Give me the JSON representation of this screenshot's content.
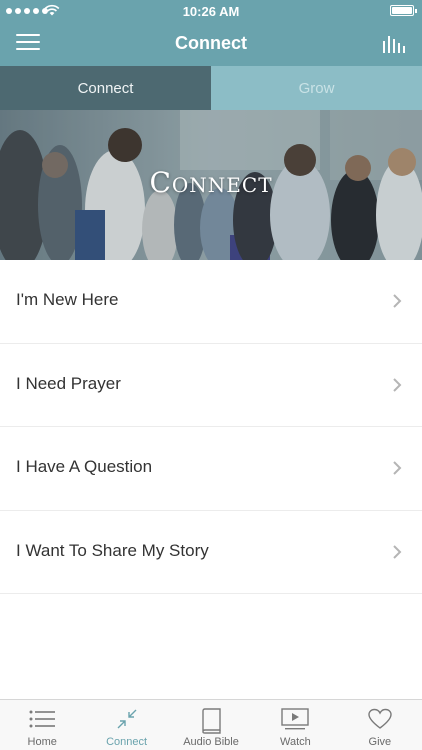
{
  "status_bar": {
    "time": "10:26 AM"
  },
  "nav": {
    "title": "Connect"
  },
  "segments": [
    {
      "label": "Connect",
      "active": true
    },
    {
      "label": "Grow",
      "active": false
    }
  ],
  "hero": {
    "title": "Connect"
  },
  "list": {
    "items": [
      {
        "label": "I'm New Here"
      },
      {
        "label": "I Need Prayer"
      },
      {
        "label": "I Have A Question"
      },
      {
        "label": "I Want To Share My Story"
      }
    ]
  },
  "tab_bar": {
    "items": [
      {
        "label": "Home",
        "icon": "list-icon",
        "active": false
      },
      {
        "label": "Connect",
        "icon": "collapse-arrows-icon",
        "active": true
      },
      {
        "label": "Audio Bible",
        "icon": "book-icon",
        "active": false
      },
      {
        "label": "Watch",
        "icon": "video-play-icon",
        "active": false
      },
      {
        "label": "Give",
        "icon": "heart-icon",
        "active": false
      }
    ]
  },
  "colors": {
    "brand_teal": "#6aa3ad",
    "segment_active": "#4d6971",
    "segment_inactive": "#8cbdc6"
  }
}
